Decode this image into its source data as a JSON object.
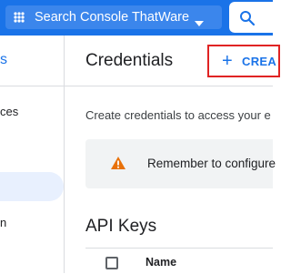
{
  "header": {
    "project_name": "Search Console ThatWare",
    "search_icon": "search-icon",
    "project_icon": "project-dots-icon",
    "dropdown_icon": "chevron-down-icon"
  },
  "sidebar": {
    "head_fragment": "s",
    "items": [
      {
        "label": "ces"
      },
      {
        "label": "n"
      }
    ]
  },
  "page": {
    "title": "Credentials",
    "create_button": {
      "icon": "plus-icon",
      "label": "+",
      "text": "CREA"
    },
    "description": "Create credentials to access your e",
    "notice": {
      "icon": "warning-icon",
      "text": "Remember to configure"
    }
  },
  "api_keys": {
    "title": "API Keys",
    "columns": [
      {
        "label": "Name"
      }
    ]
  },
  "colors": {
    "brand_blue": "#1a73e8",
    "highlight_red": "#e02323",
    "warning_orange": "#e8710a"
  }
}
